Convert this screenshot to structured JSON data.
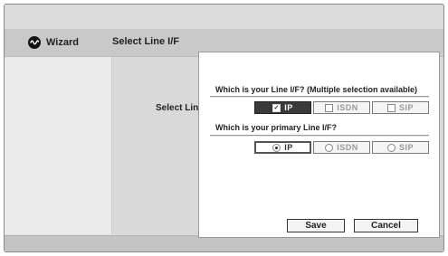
{
  "header": {
    "app_title": "Wizard",
    "app_icon": "wave-icon",
    "step_title": "Select Line I/F"
  },
  "main": {
    "field_label": "Select Line I/F"
  },
  "dialog": {
    "question1": "Which is your Line I/F? (Multiple selection available)",
    "line_if_options": [
      {
        "label": "IP",
        "checked": true
      },
      {
        "label": "ISDN",
        "checked": false
      },
      {
        "label": "SIP",
        "checked": false
      }
    ],
    "question2": "Which is your primary Line I/F?",
    "primary_options": [
      {
        "label": "IP",
        "selected": true
      },
      {
        "label": "ISDN",
        "selected": false
      },
      {
        "label": "SIP",
        "selected": false
      }
    ],
    "save_label": "Save",
    "cancel_label": "Cancel"
  },
  "colors": {
    "selected_fill": "#3a3a3a",
    "disabled_text": "#9a9a9a"
  }
}
